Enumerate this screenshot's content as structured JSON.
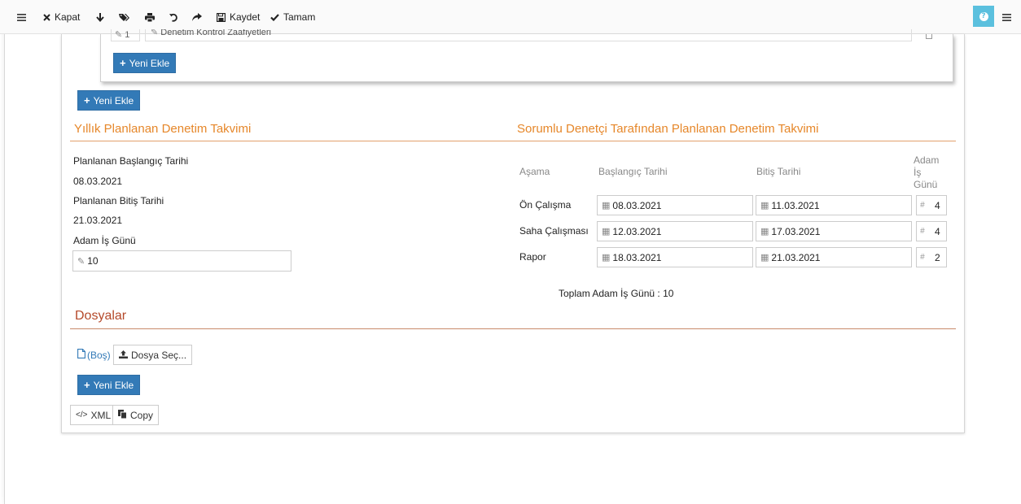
{
  "toolbar": {
    "kapat": "Kapat",
    "kaydet": "Kaydet",
    "tamam": "Tamam"
  },
  "inner_card": {
    "order_value": "1",
    "item_value": "Denetim Kontrol Zaafiyetleri",
    "add_label": "Yeni Ekle"
  },
  "outer_add_label": "Yeni Ekle",
  "yearly": {
    "title": "Yıllık Planlanan Denetim Takvimi",
    "start_label": "Planlanan Başlangıç Tarihi",
    "start_value": "08.03.2021",
    "end_label": "Planlanan Bitiş Tarihi",
    "end_value": "21.03.2021",
    "days_label": "Adam İş Günü",
    "days_value": "10"
  },
  "auditor": {
    "title": "Sorumlu Denetçi Tarafından Planlanan Denetim Takvimi",
    "headers": {
      "stage": "Aşama",
      "start": "Başlangıç Tarihi",
      "end": "Bitiş Tarihi",
      "days_1": "Adam",
      "days_2": "İş",
      "days_3": "Günü"
    },
    "rows": [
      {
        "stage": "Ön Çalışma",
        "start": "08.03.2021",
        "end": "11.03.2021",
        "days": "4"
      },
      {
        "stage": "Saha Çalışması",
        "start": "12.03.2021",
        "end": "17.03.2021",
        "days": "4"
      },
      {
        "stage": "Rapor",
        "start": "18.03.2021",
        "end": "21.03.2021",
        "days": "2"
      }
    ],
    "total": "Toplam Adam İş Günü : 10"
  },
  "files": {
    "title": "Dosyalar",
    "empty_label": "(Boş)",
    "choose_label": "Dosya Seç...",
    "add_label": "Yeni Ekle"
  },
  "footer": {
    "xml_label": "XML",
    "copy_label": "Copy"
  },
  "colors": {
    "primary": "#337ab7",
    "section_orange": "#e6872a",
    "section_red": "#b5492a",
    "help": "#5bc0de"
  }
}
